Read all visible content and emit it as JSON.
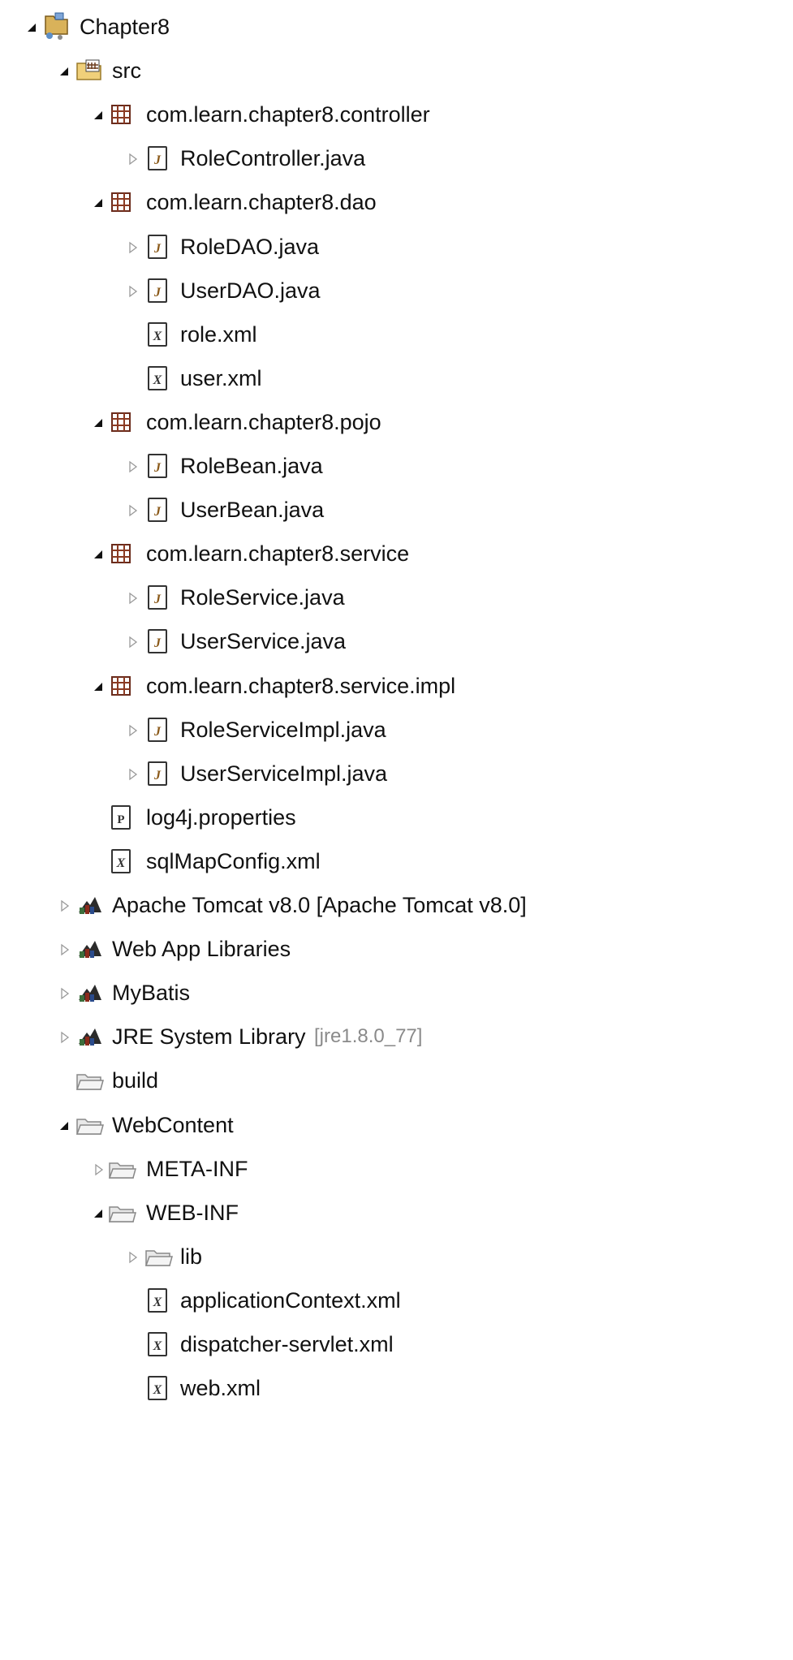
{
  "tree": {
    "nodes": [
      {
        "key": "project",
        "label": "Chapter8",
        "icon": "project-icon",
        "toggle": "expanded",
        "depth": 0
      },
      {
        "key": "src",
        "label": "src",
        "icon": "source-folder-icon",
        "toggle": "expanded",
        "depth": 1
      },
      {
        "key": "pkg-controller",
        "label": "com.learn.chapter8.controller",
        "icon": "package-icon",
        "toggle": "expanded",
        "depth": 2
      },
      {
        "key": "rolecontroller",
        "label": "RoleController.java",
        "icon": "java-file-icon",
        "toggle": "collapsed",
        "depth": 3
      },
      {
        "key": "pkg-dao",
        "label": "com.learn.chapter8.dao",
        "icon": "package-icon",
        "toggle": "expanded",
        "depth": 2
      },
      {
        "key": "roledao",
        "label": "RoleDAO.java",
        "icon": "java-file-icon",
        "toggle": "collapsed",
        "depth": 3
      },
      {
        "key": "userdao",
        "label": "UserDAO.java",
        "icon": "java-file-icon",
        "toggle": "collapsed",
        "depth": 3
      },
      {
        "key": "rolexml",
        "label": "role.xml",
        "icon": "xml-file-icon",
        "toggle": "none",
        "depth": 3
      },
      {
        "key": "userxml",
        "label": "user.xml",
        "icon": "xml-file-icon",
        "toggle": "none",
        "depth": 3
      },
      {
        "key": "pkg-pojo",
        "label": "com.learn.chapter8.pojo",
        "icon": "package-icon",
        "toggle": "expanded",
        "depth": 2
      },
      {
        "key": "rolebean",
        "label": "RoleBean.java",
        "icon": "java-file-icon",
        "toggle": "collapsed",
        "depth": 3
      },
      {
        "key": "userbean",
        "label": "UserBean.java",
        "icon": "java-file-icon",
        "toggle": "collapsed",
        "depth": 3
      },
      {
        "key": "pkg-service",
        "label": "com.learn.chapter8.service",
        "icon": "package-icon",
        "toggle": "expanded",
        "depth": 2
      },
      {
        "key": "roleservice",
        "label": "RoleService.java",
        "icon": "java-file-icon",
        "toggle": "collapsed",
        "depth": 3
      },
      {
        "key": "userservice",
        "label": "UserService.java",
        "icon": "java-file-icon",
        "toggle": "collapsed",
        "depth": 3
      },
      {
        "key": "pkg-service-impl",
        "label": "com.learn.chapter8.service.impl",
        "icon": "package-icon",
        "toggle": "expanded",
        "depth": 2
      },
      {
        "key": "roleserviceimpl",
        "label": "RoleServiceImpl.java",
        "icon": "java-file-icon",
        "toggle": "collapsed",
        "depth": 3
      },
      {
        "key": "userserviceimpl",
        "label": "UserServiceImpl.java",
        "icon": "java-file-icon",
        "toggle": "collapsed",
        "depth": 3
      },
      {
        "key": "log4j",
        "label": "log4j.properties",
        "icon": "properties-file-icon",
        "toggle": "none",
        "depth": 2
      },
      {
        "key": "sqlmapconfig",
        "label": "sqlMapConfig.xml",
        "icon": "xml-file-icon",
        "toggle": "none",
        "depth": 2
      },
      {
        "key": "tomcat-lib",
        "label": "Apache Tomcat v8.0 [Apache Tomcat v8.0]",
        "icon": "library-icon",
        "toggle": "collapsed",
        "depth": 1
      },
      {
        "key": "webapp-lib",
        "label": "Web App Libraries",
        "icon": "library-icon",
        "toggle": "collapsed",
        "depth": 1
      },
      {
        "key": "mybatis-lib",
        "label": "MyBatis",
        "icon": "library-icon",
        "toggle": "collapsed",
        "depth": 1
      },
      {
        "key": "jre-lib",
        "label": "JRE System Library",
        "decoration": "[jre1.8.0_77]",
        "icon": "library-icon",
        "toggle": "collapsed",
        "depth": 1
      },
      {
        "key": "build",
        "label": "build",
        "icon": "folder-icon",
        "toggle": "none",
        "depth": 1
      },
      {
        "key": "webcontent",
        "label": "WebContent",
        "icon": "folder-icon",
        "toggle": "expanded",
        "depth": 1
      },
      {
        "key": "meta-inf",
        "label": "META-INF",
        "icon": "folder-icon",
        "toggle": "collapsed",
        "depth": 2
      },
      {
        "key": "web-inf",
        "label": "WEB-INF",
        "icon": "folder-icon",
        "toggle": "expanded",
        "depth": 2
      },
      {
        "key": "lib",
        "label": "lib",
        "icon": "folder-icon",
        "toggle": "collapsed",
        "depth": 3
      },
      {
        "key": "appctx",
        "label": "applicationContext.xml",
        "icon": "xml-file-icon",
        "toggle": "none",
        "depth": 3
      },
      {
        "key": "dispatcher",
        "label": "dispatcher-servlet.xml",
        "icon": "xml-file-icon",
        "toggle": "none",
        "depth": 3
      },
      {
        "key": "webxml",
        "label": "web.xml",
        "icon": "xml-file-icon",
        "toggle": "none",
        "depth": 3
      }
    ]
  }
}
